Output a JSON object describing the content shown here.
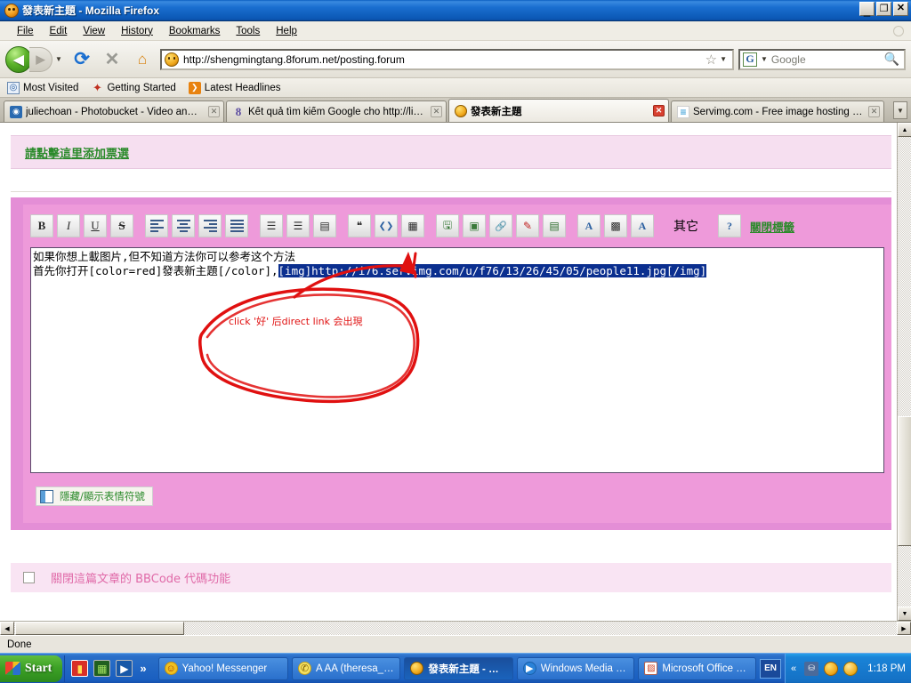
{
  "window": {
    "doc_title": "發表新主題",
    "app_name": "Mozilla Firefox",
    "title_separator": " - ",
    "minimize": "_",
    "maximize": "❐",
    "close": "✕"
  },
  "menu": {
    "items": [
      "File",
      "Edit",
      "View",
      "History",
      "Bookmarks",
      "Tools",
      "Help"
    ]
  },
  "nav": {
    "back": "◀",
    "forward": "▶",
    "dropdown": "▼",
    "reload": "⟳",
    "stop": "✕",
    "home": "⌂",
    "url": "http://shengmingtang.8forum.net/posting.forum",
    "star": "☆",
    "url_caret": "▼",
    "search_engine": "G",
    "search_caret": "▼",
    "search_placeholder": "Google",
    "search_magnifier": "🔍"
  },
  "bookmarks": {
    "items": [
      {
        "label": "Most Visited",
        "icon": "most-visited-icon",
        "glyph": "◎"
      },
      {
        "label": "Getting Started",
        "icon": "getting-started-icon",
        "glyph": "✦"
      },
      {
        "label": "Latest Headlines",
        "icon": "rss-icon",
        "glyph": "❯"
      }
    ]
  },
  "tabs": {
    "items": [
      {
        "label": "juliechoan - Photobucket - Video and I...",
        "icon": "photobucket-icon",
        "glyph": "◉",
        "active": false,
        "close": "✕"
      },
      {
        "label": "Kết quả tìm kiếm Google cho http://libr...",
        "icon": "google-8-icon",
        "glyph": "8",
        "active": false,
        "close": "✕"
      },
      {
        "label": "發表新主題",
        "icon": "firefox-icon",
        "glyph": "",
        "active": true,
        "close": "✕"
      },
      {
        "label": "Servimg.com - Free image hosting serv...",
        "icon": "servimg-icon",
        "glyph": "≡",
        "active": false,
        "close": "✕"
      }
    ],
    "list_all": "▼"
  },
  "page": {
    "poll_link": "請點擊這里添加票選",
    "editor": {
      "toolbar_buttons": [
        {
          "name": "bold-button",
          "glyph": "B",
          "style": "bold"
        },
        {
          "name": "italic-button",
          "glyph": "I",
          "style": "italic"
        },
        {
          "name": "underline-button",
          "glyph": "U",
          "style": "underline"
        },
        {
          "name": "strikethrough-button",
          "glyph": "S",
          "style": "strike"
        },
        {
          "name": "align-left-button",
          "glyph": "",
          "style": "bars-left"
        },
        {
          "name": "align-center-button",
          "glyph": "",
          "style": "bars-center"
        },
        {
          "name": "align-right-button",
          "glyph": "",
          "style": "bars-right"
        },
        {
          "name": "align-justify-button",
          "glyph": "",
          "style": "bars-justify"
        },
        {
          "name": "bullet-list-button",
          "glyph": "☰",
          "style": "icon"
        },
        {
          "name": "numbered-list-button",
          "glyph": "☰",
          "style": "icon"
        },
        {
          "name": "indent-button",
          "glyph": "▤",
          "style": "icon"
        },
        {
          "name": "quote-button",
          "glyph": "❝",
          "style": "icon"
        },
        {
          "name": "code-button",
          "glyph": "❮❯",
          "style": "icon"
        },
        {
          "name": "table-button",
          "glyph": "▦",
          "style": "icon"
        },
        {
          "name": "insert-image-button",
          "glyph": "🖫",
          "style": "icon"
        },
        {
          "name": "image-gallery-button",
          "glyph": "▣",
          "style": "icon"
        },
        {
          "name": "link-button",
          "glyph": "🔗",
          "style": "icon"
        },
        {
          "name": "flash-button",
          "glyph": "✎",
          "style": "icon"
        },
        {
          "name": "video-button",
          "glyph": "▤",
          "style": "icon"
        },
        {
          "name": "font-color-button",
          "glyph": "A",
          "style": "icon"
        },
        {
          "name": "color-palette-button",
          "glyph": "▩",
          "style": "icon"
        },
        {
          "name": "font-face-button",
          "glyph": "A",
          "style": "icon"
        },
        {
          "name": "other-button",
          "glyph": "其它",
          "style": "wide"
        },
        {
          "name": "help-button",
          "glyph": "?",
          "style": "icon"
        }
      ],
      "close_tags_link": "關閉標籤",
      "content_line1": "如果你想上載图片,但不知道方法你可以参考这个方法",
      "content_line2_pre": "首先你打开[color=red]發表新主題[/color],",
      "content_line2_selected": "[img]http://i76.servimg.com/u/f76/13/26/45/05/people11.jpg[/img]",
      "annotation_text": "click '好' 后direct link 会出現",
      "annotation_color": "#e01010",
      "smiley_toggle_label": "隱藏/顯示表情符號"
    },
    "bbcode_label": "關閉這篇文章的 BBCode 代碼功能",
    "bbcode_checked": false
  },
  "scroll": {
    "up": "▲",
    "down": "▼",
    "left": "◀",
    "right": "▶"
  },
  "status": {
    "text": "Done"
  },
  "taskbar": {
    "start_label": "Start",
    "quicklaunch": [
      {
        "name": "quicklaunch-icon-1",
        "glyph": "▮",
        "color": "red"
      },
      {
        "name": "quicklaunch-icon-2",
        "glyph": "▦",
        "color": "green"
      },
      {
        "name": "quicklaunch-icon-3",
        "glyph": "▶",
        "color": "blue"
      }
    ],
    "quicklaunch_more": "»",
    "tasks": [
      {
        "label": "Yahoo! Messenger",
        "icon": "yahoo-messenger-icon",
        "glyph": "☺",
        "active": false
      },
      {
        "label": "A AA (theresa_truc)...",
        "icon": "aim-icon",
        "glyph": "✆",
        "active": false
      },
      {
        "label": "發表新主題 - Mozi...",
        "icon": "firefox-icon",
        "glyph": "",
        "active": true
      },
      {
        "label": "Windows Media Player",
        "icon": "media-player-icon",
        "glyph": "▶",
        "active": false
      },
      {
        "label": "Microsoft Office Pict...",
        "icon": "office-picture-manager-icon",
        "glyph": "▨",
        "active": false
      }
    ],
    "language": "EN",
    "tray_arrow": "«",
    "tray_icons": [
      {
        "name": "network-icon",
        "glyph": "⛁"
      },
      {
        "name": "messenger-tray-icon",
        "glyph": "☺"
      },
      {
        "name": "security-alert-icon",
        "glyph": "!"
      }
    ],
    "clock": "1:18 PM"
  }
}
